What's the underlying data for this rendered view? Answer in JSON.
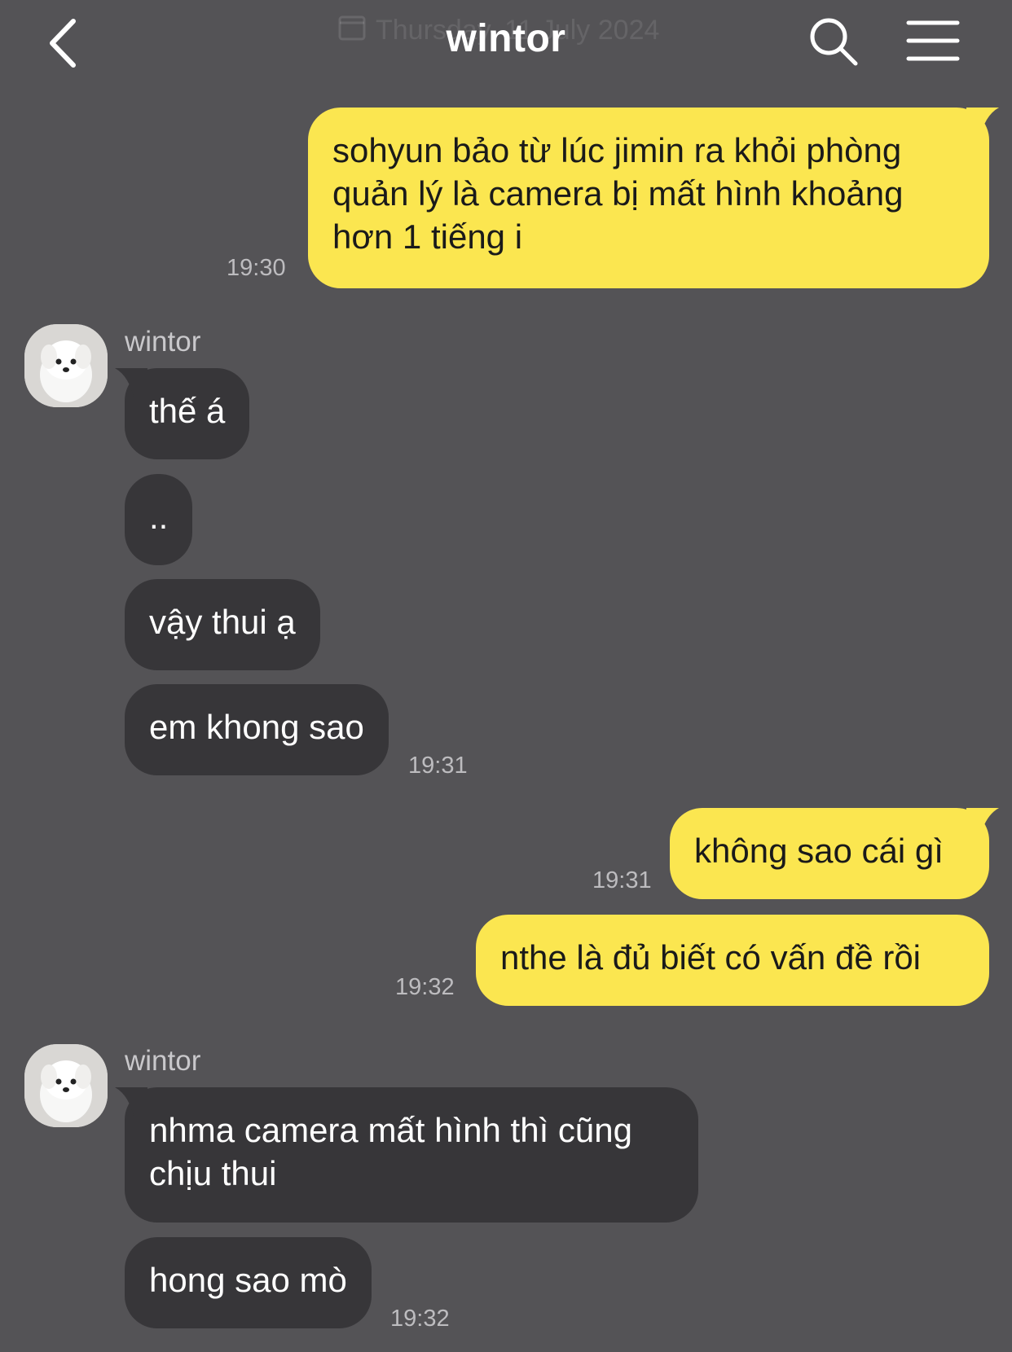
{
  "header": {
    "title": "wintor",
    "date_banner": "Thursday, 11 July 2024",
    "icons": {
      "back": "chevron-left-icon",
      "search": "search-icon",
      "menu": "hamburger-menu-icon",
      "calendar": "calendar-icon"
    }
  },
  "colors": {
    "background": "#545356",
    "my_bubble": "#fbe650",
    "their_bubble": "#373639",
    "timestamp": "#bdbcbf"
  },
  "messages": [
    {
      "from": "me",
      "text": "sohyun bảo từ lúc jimin ra khỏi phòng quản lý là camera bị mất hình khoảng hơn 1 tiếng i",
      "time": "19:30"
    },
    {
      "from": "them",
      "sender": "wintor",
      "text": "thế á"
    },
    {
      "from": "them",
      "text": ".."
    },
    {
      "from": "them",
      "text": "vậy thui ạ"
    },
    {
      "from": "them",
      "text": "em khong sao",
      "time": "19:31"
    },
    {
      "from": "me",
      "text": "không sao cái gì",
      "time": "19:31"
    },
    {
      "from": "me",
      "text": "nthe là đủ biết có vấn đề rồi",
      "time": "19:32"
    },
    {
      "from": "them",
      "sender": "wintor",
      "text": "nhma camera mất hình thì cũng chịu thui"
    },
    {
      "from": "them",
      "text": "hong sao mò",
      "time": "19:32"
    }
  ]
}
